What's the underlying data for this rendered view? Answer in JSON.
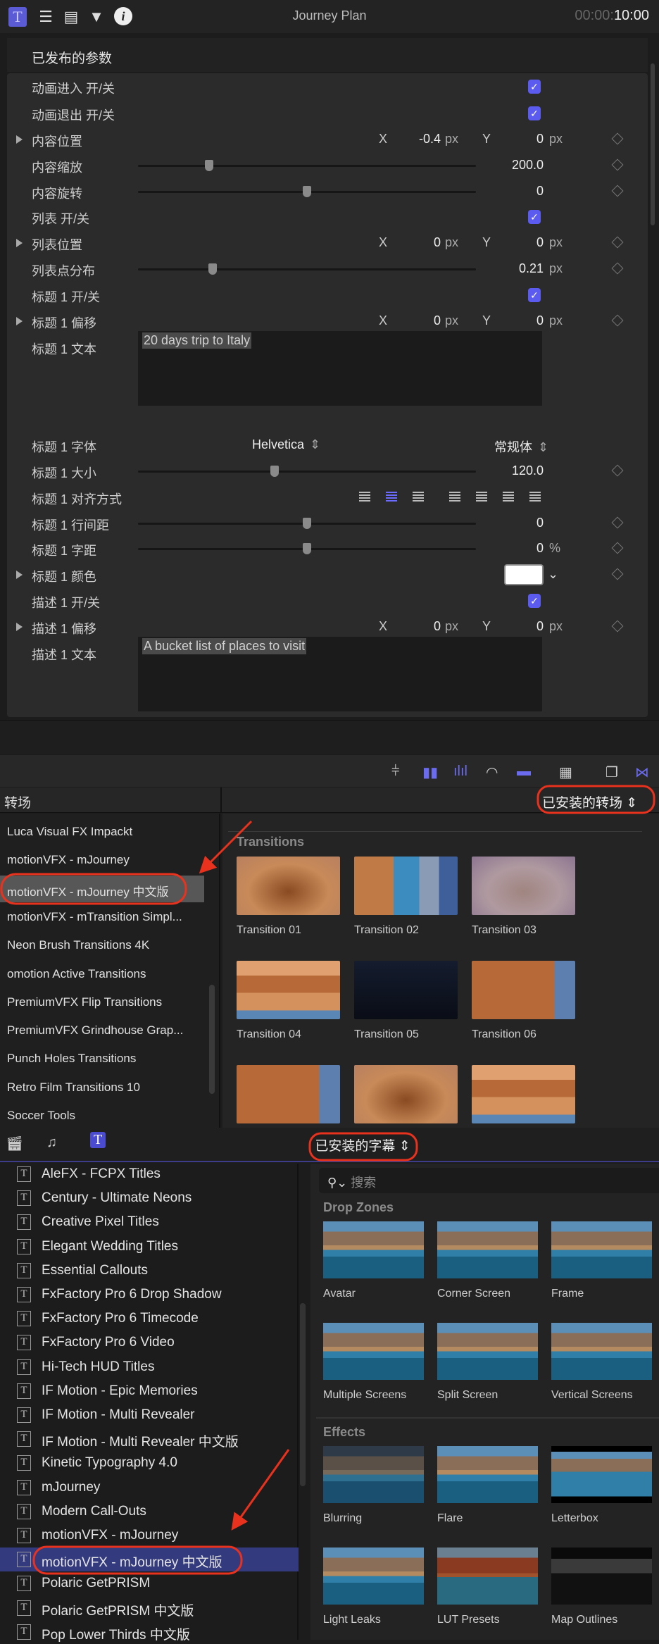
{
  "header": {
    "title": "Journey Plan",
    "timecode_dim": "00:00:",
    "timecode": "10:00",
    "icons": [
      "title-inspector-icon",
      "text-inspector-icon",
      "video-inspector-icon",
      "color-inspector-icon",
      "info-icon"
    ]
  },
  "published": {
    "heading": "已发布的参数",
    "rows": [
      {
        "label": "动画进入 开/关",
        "type": "checkbox",
        "checked": true
      },
      {
        "label": "动画退出 开/关",
        "type": "checkbox",
        "checked": true
      },
      {
        "label": "内容位置",
        "type": "xy",
        "x": "-0.4",
        "y": "0",
        "unit": "px",
        "expandable": true
      },
      {
        "label": "内容缩放",
        "type": "slider",
        "value": "200.0",
        "fraction": 0.21
      },
      {
        "label": "内容旋转",
        "type": "slider",
        "value": "0",
        "fraction": 0.5
      },
      {
        "label": "列表 开/关",
        "type": "checkbox",
        "checked": true
      },
      {
        "label": "列表位置",
        "type": "xy",
        "x": "0",
        "y": "0",
        "unit": "px",
        "expandable": true
      },
      {
        "label": "列表点分布",
        "type": "slider",
        "value": "0.21",
        "unit": "px",
        "fraction": 0.22
      },
      {
        "label": "标题 1 开/关",
        "type": "checkbox",
        "checked": true
      },
      {
        "label": "标题 1 偏移",
        "type": "xy",
        "x": "0",
        "y": "0",
        "unit": "px",
        "expandable": true
      },
      {
        "label": "标题 1 文本",
        "type": "textarea",
        "text": "20 days trip to Italy"
      },
      {
        "label": "标题 1 字体",
        "type": "popup",
        "font": "Helvetica",
        "style": "常规体"
      },
      {
        "label": "标题 1 大小",
        "type": "slider",
        "value": "120.0",
        "fraction": 0.405
      },
      {
        "label": "标题 1 对齐方式",
        "type": "align",
        "selected": 1
      },
      {
        "label": "标题 1 行间距",
        "type": "slider",
        "value": "0",
        "fraction": 0.5
      },
      {
        "label": "标题 1 字距",
        "type": "slider",
        "value": "0",
        "unit": "%",
        "fraction": 0.5
      },
      {
        "label": "标题 1 颜色",
        "type": "color",
        "color": "#ffffff",
        "expandable": true
      },
      {
        "label": "描述 1 开/关",
        "type": "checkbox",
        "checked": true
      },
      {
        "label": "描述 1 偏移",
        "type": "xy",
        "x": "0",
        "y": "0",
        "unit": "px",
        "expandable": true
      },
      {
        "label": "描述 1 文本",
        "type": "textarea",
        "text": "A bucket list of places to visit"
      }
    ],
    "x_label": "X",
    "y_label": "Y"
  },
  "transitions": {
    "sidebar_title": "转场",
    "filter": "已安装的转场",
    "items": [
      "Luca Visual FX Impackt",
      "motionVFX - mJourney",
      "motionVFX - mJourney 中文版",
      "motionVFX - mTransition Simpl...",
      "Neon Brush Transitions 4K",
      "omotion Active Transitions",
      "PremiumVFX Flip Transitions",
      "PremiumVFX Grindhouse Grap...",
      "Punch Holes Transitions",
      "Retro Film Transitions 10",
      "Soccer Tools"
    ],
    "selected_index": 2,
    "section": "Transitions",
    "thumbs": [
      "Transition 01",
      "Transition 02",
      "Transition 03",
      "Transition 04",
      "Transition 05",
      "Transition 06",
      "",
      "",
      ""
    ]
  },
  "titles": {
    "filter": "已安装的字幕",
    "search_placeholder": "搜索",
    "items": [
      "AleFX - FCPX Titles",
      "Century - Ultimate Neons",
      "Creative Pixel Titles",
      "Elegant Wedding Titles",
      "Essential Callouts",
      "FxFactory Pro 6 Drop Shadow",
      "FxFactory Pro 6 Timecode",
      "FxFactory Pro 6 Video",
      "Hi-Tech HUD Titles",
      "IF Motion - Epic Memories",
      "IF Motion - Multi Revealer",
      "IF Motion - Multi Revealer 中文版",
      "Kinetic Typography 4.0",
      "mJourney",
      "Modern Call-Outs",
      "motionVFX - mJourney",
      "motionVFX - mJourney 中文版",
      "Polaric GetPRISM",
      "Polaric GetPRISM 中文版",
      "Pop Lower Thirds 中文版"
    ],
    "selected_index": 16,
    "sections": [
      {
        "name": "Drop Zones",
        "items": [
          "Avatar",
          "Corner Screen",
          "Frame",
          "Multiple Screens",
          "Split Screen",
          "Vertical Screens"
        ]
      },
      {
        "name": "Effects",
        "items": [
          "Blurring",
          "Flare",
          "Letterbox",
          "Light Leaks",
          "LUT Presets",
          "Map Outlines"
        ]
      }
    ]
  },
  "colors": {
    "accent": "#5b5bf0",
    "annotation": "#e8321e",
    "selected_title": "#343a7e"
  }
}
